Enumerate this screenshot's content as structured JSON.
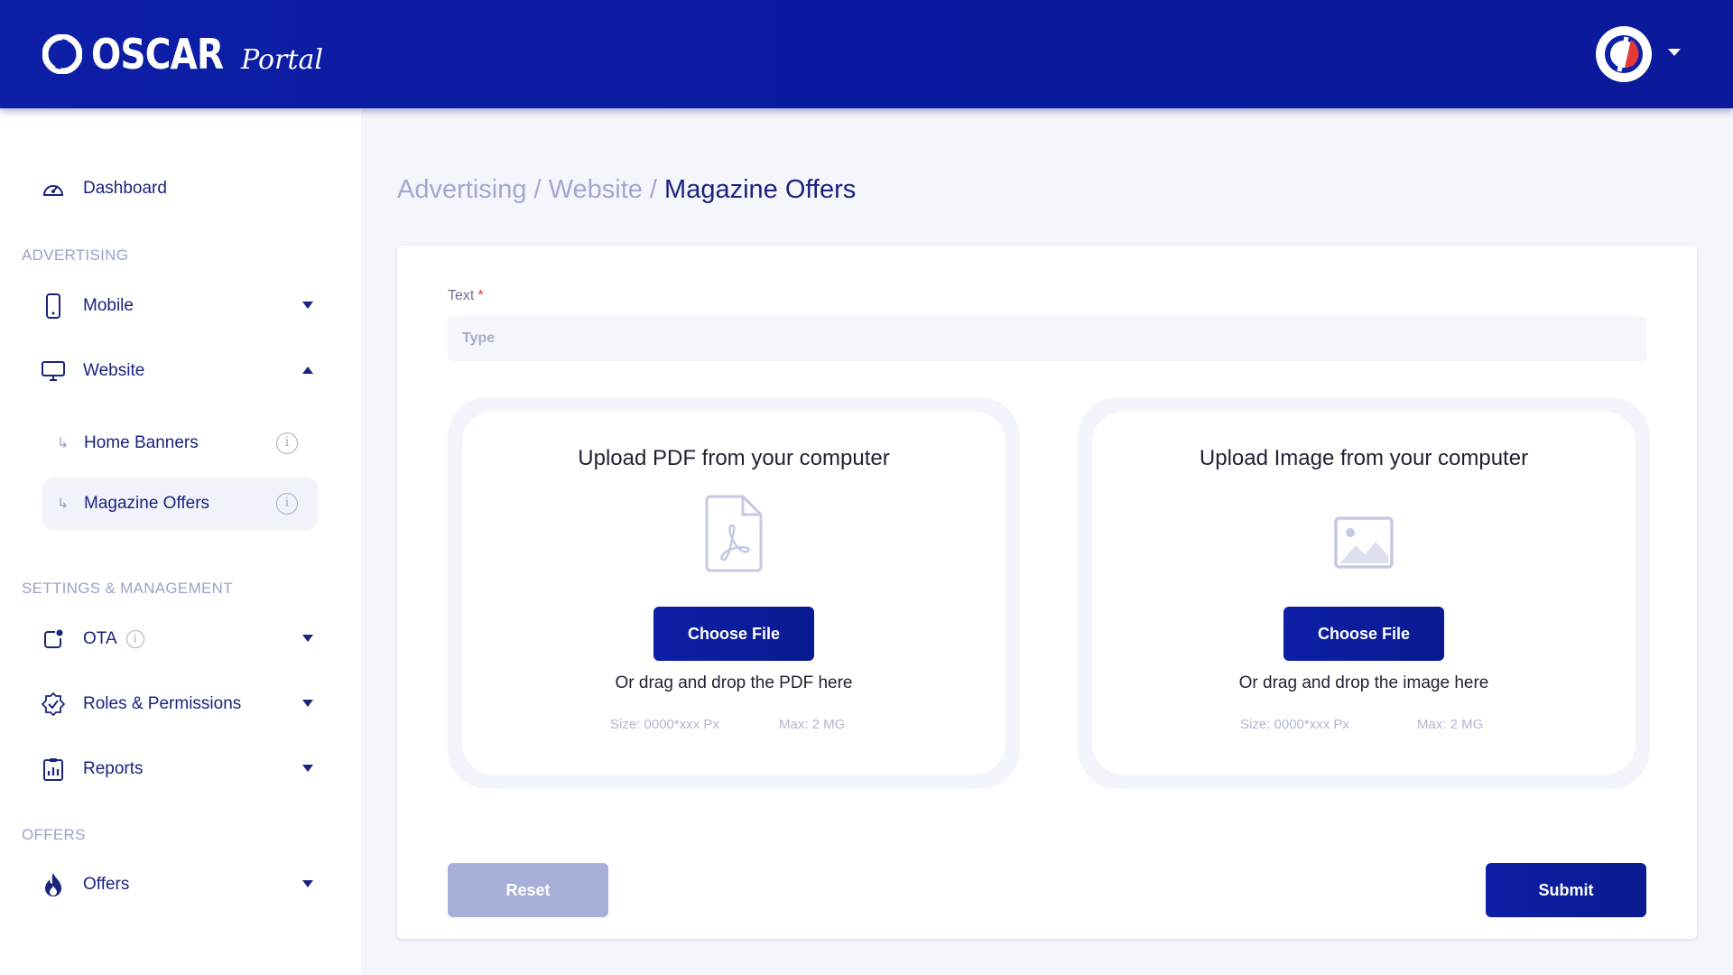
{
  "header": {
    "brand": "OSCAR",
    "brand_sub": "Portal",
    "logo_icon": "oscar-logo-icon",
    "avatar_icon": "user-avatar-icon",
    "menu_icon": "chevron-down-icon",
    "background": "#0d1fa6"
  },
  "sidebar": {
    "dashboard": {
      "label": "Dashboard",
      "icon": "speedometer-icon"
    },
    "section_advertising": "ADVERTISING",
    "mobile": {
      "label": "Mobile",
      "icon": "mobile-phone-icon"
    },
    "website": {
      "label": "Website",
      "icon": "monitor-icon"
    },
    "home_banners": {
      "label": "Home Banners"
    },
    "magazine_offers": {
      "label": "Magazine Offers"
    },
    "section_settings": "SETTINGS &  MANAGEMENT",
    "ota": {
      "label": "OTA",
      "icon": "ota-icon"
    },
    "roles": {
      "label": "Roles & Permissions",
      "icon": "badge-check-icon"
    },
    "reports": {
      "label": "Reports",
      "icon": "report-chart-icon"
    },
    "section_offers": "OFFERS",
    "offers": {
      "label": "Offers",
      "icon": "flame-icon"
    }
  },
  "breadcrumb": {
    "part1": "Advertising / ",
    "part2": "Website / ",
    "current": "Magazine Offers"
  },
  "form": {
    "text_label": "Text",
    "required_mark": "*",
    "text_placeholder": "Type",
    "text_value": "",
    "pdf_upload": {
      "title": "Upload PDF from your computer",
      "button": "Choose File",
      "drag_text": "Or drag and drop the PDF here",
      "size": "Size: 0000*xxx Px",
      "max": "Max: 2 MG",
      "icon": "pdf-file-icon"
    },
    "image_upload": {
      "title": "Upload Image from your computer",
      "button": "Choose File",
      "drag_text": "Or drag and drop the image here",
      "size": "Size: 0000*xxx Px",
      "max": "Max: 2 MG",
      "icon": "image-icon"
    },
    "reset": "Reset",
    "submit": "Submit"
  },
  "colors": {
    "primary": "#0d1fa6",
    "text_dark": "#1a237e",
    "muted": "#a2a8d0",
    "reset_button": "#a8afd9",
    "required": "#e53935"
  }
}
